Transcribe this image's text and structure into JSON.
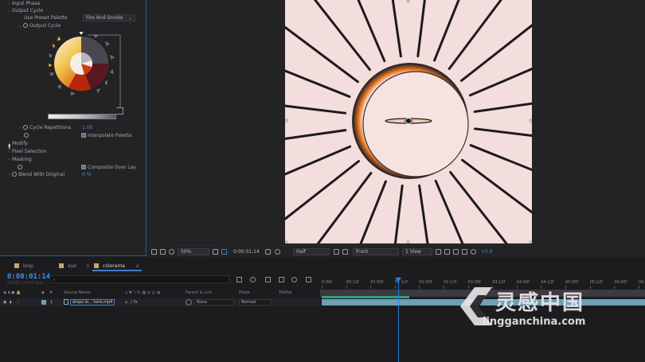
{
  "effect_controls": {
    "input_phase": "Input Phase",
    "output_cycle": "Output Cycle",
    "use_preset_palette_label": "Use Preset Palette",
    "use_preset_palette_value": "Fire And Smoke",
    "output_cycle_sub": "Output Cycle",
    "cycle_repetitions_label": "Cycle Repetitions",
    "cycle_repetitions_value": "1.00",
    "interpolate_palette": "Interpolate Palette",
    "modify": "Modify",
    "pixel_selection": "Pixel Selection",
    "masking": "Masking",
    "composite_over_layer": "Composite Over Lay",
    "blend_with_original_label": "Blend With Original",
    "blend_with_original_value": "0 %",
    "wheel_colors": [
      "#f5f3ea",
      "#f3d06a",
      "#e88a1e",
      "#c7350f",
      "#7b1413",
      "#3a2a33",
      "#5b5f75",
      "#8f95ad"
    ]
  },
  "viewer_toolbar": {
    "zoom": "50%",
    "timecode": "0:00:01:14",
    "resolution": "Half",
    "view": "Front",
    "view_count": "1 View",
    "exposure": "+0.0"
  },
  "timeline": {
    "tabs": [
      {
        "label": "loop"
      },
      {
        "label": "eye"
      },
      {
        "label": "colorama"
      }
    ],
    "timecode": "0:00:01:14",
    "timecode_sub": "00038 (24.00 fps)",
    "search_placeholder": "",
    "headers": {
      "num": "#",
      "source_name": "Source Name",
      "parent_link": "Parent & Link",
      "mode": "Mode",
      "trkmat": "TrkMat"
    },
    "layer": {
      "number": "1",
      "name": "drops lo... here.mp4",
      "parent": "None",
      "mode": "Normal"
    },
    "ruler_ticks": [
      "0:00f",
      "00:12f",
      "01:00f",
      "01:12f",
      "02:00f",
      "02:12f",
      "03:00f",
      "03:12f",
      "04:00f",
      "04:12f",
      "05:00f",
      "05:12f",
      "06:00f",
      "06:12f"
    ]
  },
  "watermark": {
    "cn": "灵感中国",
    "en": "lingganchina.com"
  },
  "colors": {
    "accent": "#3d7fcc",
    "frame_bg": "#f3dedd",
    "ray": "#1e1a1a"
  }
}
